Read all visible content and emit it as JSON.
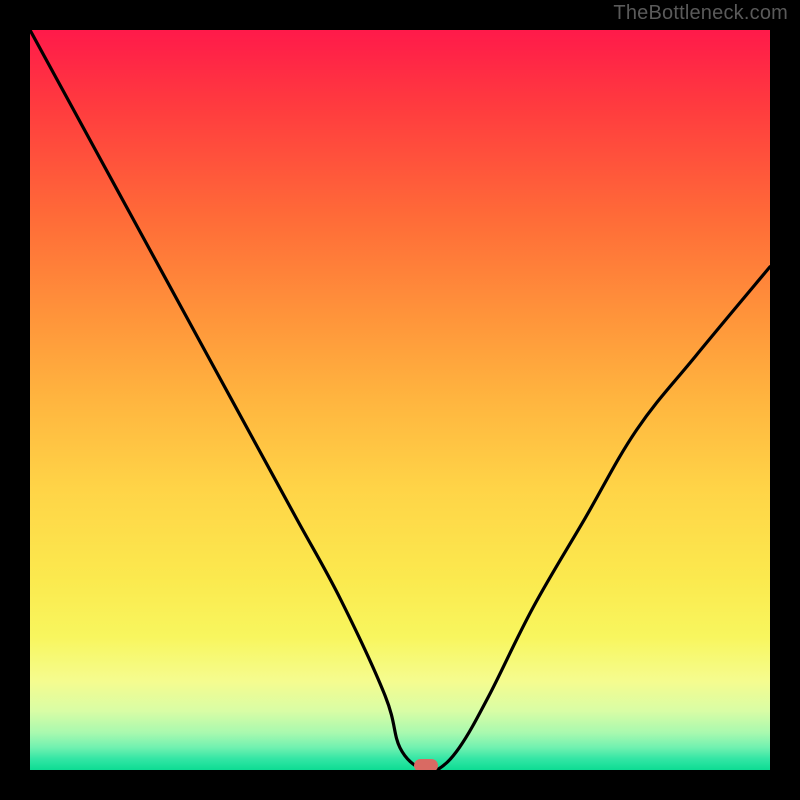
{
  "watermark": "TheBottleneck.com",
  "chart_data": {
    "type": "line",
    "title": "",
    "xlabel": "",
    "ylabel": "",
    "xlim": [
      0,
      100
    ],
    "ylim": [
      0,
      100
    ],
    "grid": false,
    "legend": false,
    "series": [
      {
        "name": "bottleneck-curve",
        "x": [
          0,
          6,
          12,
          18,
          24,
          30,
          36,
          42,
          48,
          50,
          53,
          55,
          58,
          62,
          68,
          75,
          82,
          90,
          100
        ],
        "y": [
          100,
          89,
          78,
          67,
          56,
          45,
          34,
          23,
          10,
          3,
          0,
          0,
          3,
          10,
          22,
          34,
          46,
          56,
          68
        ]
      }
    ],
    "marker": {
      "x": 53.5,
      "y": 0.5
    },
    "gradient_stops": [
      {
        "pos": 0,
        "color": "#ff1a4a"
      },
      {
        "pos": 0.1,
        "color": "#ff3a3f"
      },
      {
        "pos": 0.25,
        "color": "#ff6a38"
      },
      {
        "pos": 0.38,
        "color": "#ff923a"
      },
      {
        "pos": 0.5,
        "color": "#ffb53f"
      },
      {
        "pos": 0.62,
        "color": "#ffd447"
      },
      {
        "pos": 0.74,
        "color": "#fbe94e"
      },
      {
        "pos": 0.82,
        "color": "#f8f65e"
      },
      {
        "pos": 0.88,
        "color": "#f5fc8f"
      },
      {
        "pos": 0.92,
        "color": "#d9fda5"
      },
      {
        "pos": 0.95,
        "color": "#a8f9af"
      },
      {
        "pos": 0.97,
        "color": "#6ff1b0"
      },
      {
        "pos": 0.985,
        "color": "#33e6a5"
      },
      {
        "pos": 1.0,
        "color": "#0ddc93"
      }
    ]
  }
}
